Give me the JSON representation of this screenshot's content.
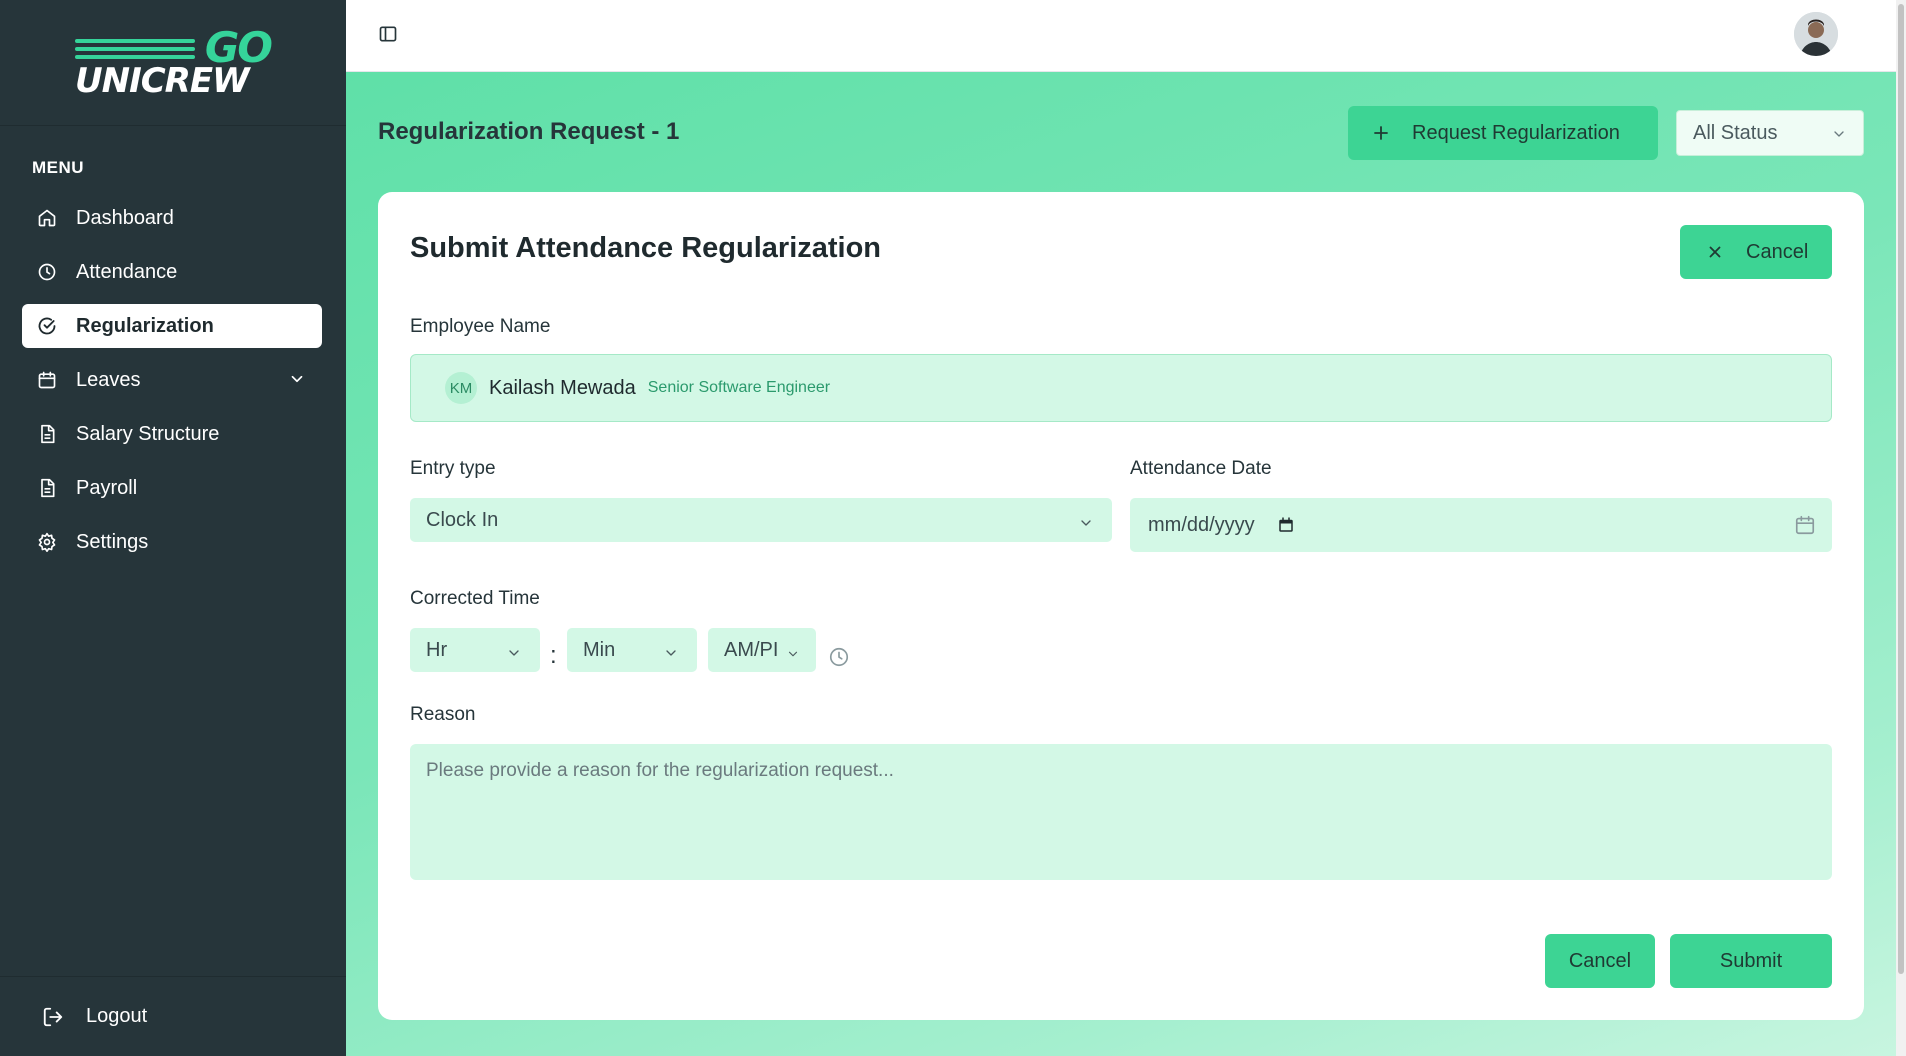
{
  "brand": {
    "logo_top": "GO",
    "logo_bottom": "UNICREW",
    "accent": "#3dd494",
    "sidebar_bg": "#26353a"
  },
  "sidebar": {
    "menu_label": "MENU",
    "items": [
      {
        "label": "Dashboard",
        "icon": "home-icon"
      },
      {
        "label": "Attendance",
        "icon": "clock-icon"
      },
      {
        "label": "Regularization",
        "icon": "check-circle-icon",
        "active": true
      },
      {
        "label": "Leaves",
        "icon": "calendar-icon",
        "has_children": true
      },
      {
        "label": "Salary Structure",
        "icon": "document-icon"
      },
      {
        "label": "Payroll",
        "icon": "document-icon"
      },
      {
        "label": "Settings",
        "icon": "gear-icon"
      }
    ],
    "logout_label": "Logout"
  },
  "header": {
    "page_title": "Regularization Request - 1",
    "request_button_label": "Request Regularization",
    "status_filter": "All Status"
  },
  "form": {
    "title": "Submit Attendance Regularization",
    "cancel_top_label": "Cancel",
    "employee_label": "Employee Name",
    "employee": {
      "initials": "KM",
      "name": "Kailash Mewada",
      "role": "Senior Software Engineer"
    },
    "entry_type_label": "Entry type",
    "entry_type_value": "Clock In",
    "attendance_date_label": "Attendance Date",
    "attendance_date_placeholder": "mm/dd/yyyy",
    "corrected_time_label": "Corrected Time",
    "hour_value": "Hr",
    "minute_value": "Min",
    "ampm_value": "AM/PI",
    "time_separator": ":",
    "reason_label": "Reason",
    "reason_placeholder": "Please provide a reason for the regularization request...",
    "cancel_label": "Cancel",
    "submit_label": "Submit"
  }
}
